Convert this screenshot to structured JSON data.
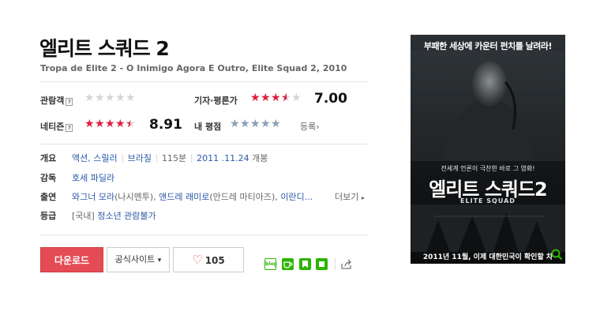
{
  "movie": {
    "title": "엘리트 스쿼드 2",
    "subtitle": "Tropa de Elite 2 - O Inimigo Agora E Outro, Elite Squad 2, 2010"
  },
  "ratings": {
    "audience": {
      "label": "관람객",
      "help": "?",
      "star_fraction": 0
    },
    "critic": {
      "label": "기자·평론가",
      "score": "7.00",
      "star_fraction": 0.7
    },
    "netizen": {
      "label": "네티즌",
      "help": "?",
      "score": "8.91",
      "star_fraction": 0.891
    },
    "mine": {
      "label": "내 평점",
      "register_label": "등록",
      "register_arrow": "›",
      "star_fraction": 0
    }
  },
  "info": {
    "overview_label": "개요",
    "genre": "액션, 스릴러",
    "country": "브라질",
    "runtime": "115분",
    "release_date": "2011 .11.24",
    "release_suffix": "개봉",
    "director_label": "감독",
    "director": "호세 파딜라",
    "cast_label": "출연",
    "cast_1": "와그너 모라",
    "cast_1_role": "(나시멘투),",
    "cast_2": "앤드레 래미로",
    "cast_2_role": "(안드레 마티아즈),",
    "cast_3": "이란디...",
    "more_label": "더보기",
    "more_arrow": "▸",
    "rating_label": "등급",
    "rating_country": "[국내]",
    "rating_value": "청소년 관람불가"
  },
  "actions": {
    "download_label": "다운로드",
    "official_site_label": "공식사이트",
    "official_site_arrow": "▾",
    "like_icon": "♡",
    "like_count": "105"
  },
  "share": {
    "icons": [
      "blog-icon",
      "cafe-icon",
      "bookmark-icon",
      "band-icon",
      "share-icon"
    ],
    "blog_text": "blog"
  },
  "poster": {
    "tagline": "부패한 세상에 카운터 펀치를 날려라!",
    "copy": "전세계 언론이 극찬한 바로 그 영화!",
    "title": "엘리트 스쿼드2",
    "subtitle": "ELITE SQUAD",
    "bottom_text": "2011년 11월, 이제 대한민국이 확인할 차"
  },
  "colors": {
    "accent_red": "#e54b54",
    "star_red": "#e01f3c",
    "star_gray": "#8aa0b6",
    "link_blue": "#2a5aa8"
  }
}
